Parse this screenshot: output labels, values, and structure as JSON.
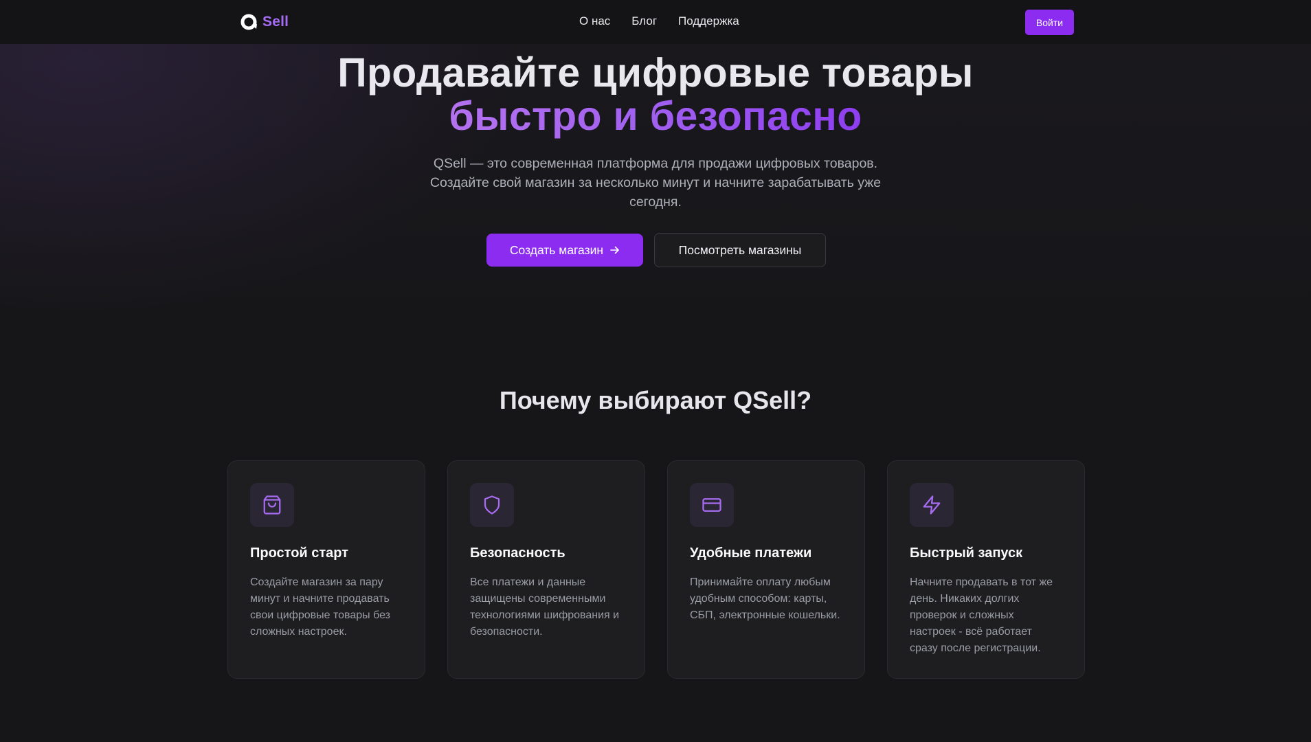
{
  "nav": {
    "logo_text": "Sell",
    "links": [
      "О нас",
      "Блог",
      "Поддержка"
    ],
    "login_label": "Войти"
  },
  "hero": {
    "title_line1": "Продавайте цифровые товары",
    "title_line2": "быстро и безопасно",
    "description": "QSell — это современная платформа для продажи цифровых товаров. Создайте свой магазин за несколько минут и начните зарабатывать уже сегодня.",
    "primary_button": "Создать магазин",
    "secondary_button": "Посмотреть магазины"
  },
  "features": {
    "title": "Почему выбирают QSell?",
    "cards": [
      {
        "icon": "shopping-bag-icon",
        "title": "Простой старт",
        "text": "Создайте магазин за пару минут и начните продавать свои цифровые товары без сложных настроек."
      },
      {
        "icon": "shield-icon",
        "title": "Безопасность",
        "text": "Все платежи и данные защищены современными технологиями шифрования и безопасности."
      },
      {
        "icon": "credit-card-icon",
        "title": "Удобные платежи",
        "text": "Принимайте оплату любым удобным способом: карты, СБП, электронные кошельки."
      },
      {
        "icon": "lightning-icon",
        "title": "Быстрый запуск",
        "text": "Начните продавать в тот же день. Никаких долгих проверок и сложных настроек - всё работает сразу после регистрации."
      }
    ]
  },
  "colors": {
    "accent": "#8b2cf0",
    "background": "#161618",
    "card": "#1e1e21"
  }
}
